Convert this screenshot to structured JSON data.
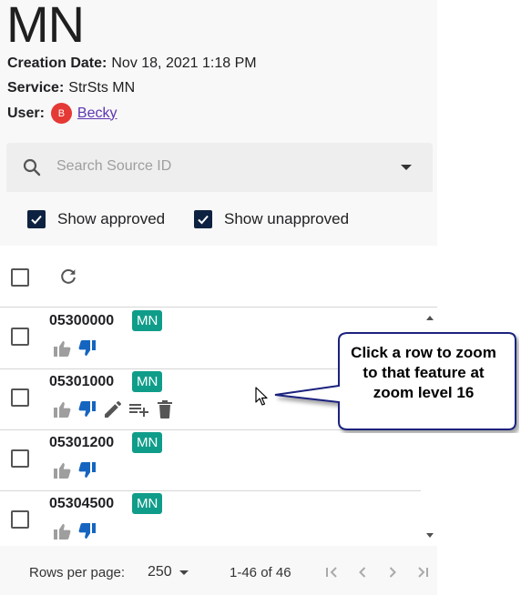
{
  "header": {
    "title": "MN",
    "creation_label": "Creation Date:",
    "creation_value": "Nov 18, 2021 1:18 PM",
    "service_label": "Service:",
    "service_value": "StrSts MN",
    "user_label": "User:",
    "user_initial": "B",
    "user_name": "Becky"
  },
  "search": {
    "placeholder": "Search Source ID",
    "icon": "search-icon"
  },
  "filters": {
    "approved_label": "Show approved",
    "approved_checked": true,
    "unapproved_label": "Show unapproved",
    "unapproved_checked": true
  },
  "rows": [
    {
      "source_id": "05300000",
      "badge": "MN"
    },
    {
      "source_id": "05301000",
      "badge": "MN"
    },
    {
      "source_id": "05301200",
      "badge": "MN"
    },
    {
      "source_id": "05304500",
      "badge": "MN"
    }
  ],
  "pagination": {
    "rows_per_page_label": "Rows per page:",
    "rows_per_page_value": "250",
    "range": "1-46 of 46"
  },
  "callout": {
    "text": "Click a row to zoom to that feature at zoom level 16"
  },
  "colors": {
    "badge": "#0f9d8a",
    "thumb_up": "#9e9e9e",
    "thumb_down": "#1565c0",
    "checkbox_checked": "#0d2240",
    "avatar": "#e53935",
    "link": "#5e35b1"
  }
}
